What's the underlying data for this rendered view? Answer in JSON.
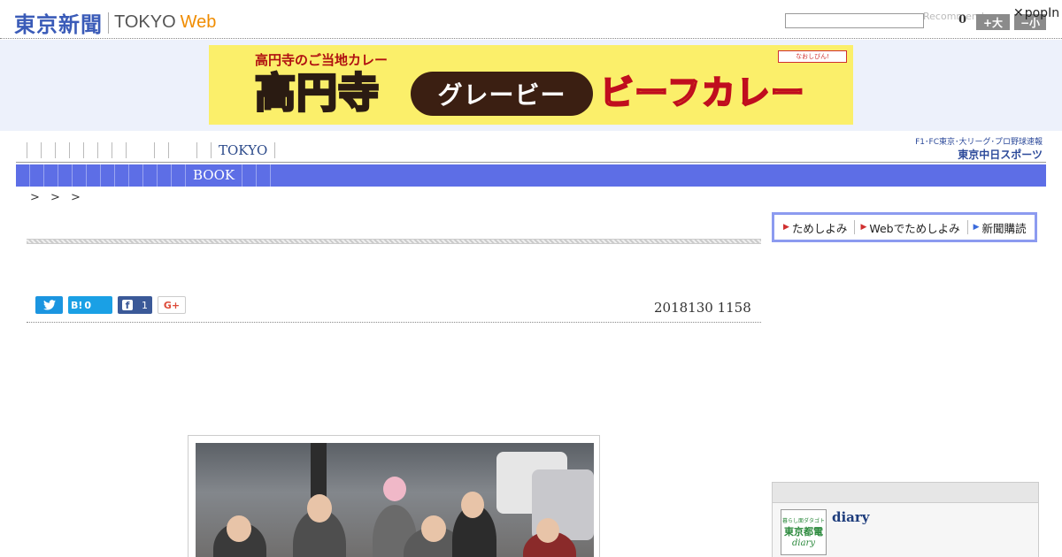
{
  "header": {
    "logo_jp": "東京新聞",
    "logo_tokyo": "TOKYO",
    "logo_web": "Web",
    "search_placeholder": "",
    "recommend_label": "Recommend",
    "recommend_count": "0",
    "font_large": "+大",
    "font_small": "−小",
    "popin_close": "✕",
    "popin_brand": "popIn"
  },
  "ad": {
    "subtitle": "高円寺のご当地カレー",
    "main": "高円寺",
    "gravy": "グレービー",
    "beef": "ビーフカレー",
    "badge": "なおしびん!"
  },
  "nav": {
    "top_item": "TOKYO",
    "bar_item": "BOOK",
    "chunichi_line1": "F1･FC東京･大リーグ･プロ野球速報",
    "chunichi_line2": "東京中日スポーツ"
  },
  "breadcrumb": "> > >",
  "trial": {
    "item1": "ためしよみ",
    "item2": "Webでためしよみ",
    "item3": "新聞購読"
  },
  "share": {
    "twitter_icon": "twitter-icon",
    "hatena_label": "B!",
    "hatena_count": "0",
    "facebook_count": "1",
    "gplus_label": "G+"
  },
  "article": {
    "date": "2018130 1158"
  },
  "side": {
    "thumb_line1": "暮らし面ダタゴト",
    "thumb_line2": "東京都電",
    "thumb_line3": "diary",
    "title": "diary"
  },
  "colors": {
    "brand_blue": "#3a5bb8",
    "web_orange": "#f08c00",
    "nav_bar": "#5d6ee6",
    "ad_yellow": "#fbef6a"
  }
}
